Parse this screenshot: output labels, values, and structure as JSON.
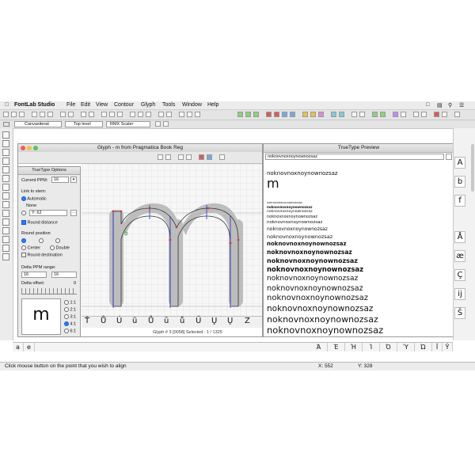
{
  "menubar": {
    "app": "FontLab Studio",
    "items": [
      "File",
      "Edit",
      "View",
      "Contour",
      "Glyph",
      "Tools",
      "Window",
      "Help"
    ]
  },
  "toolbar": {
    "layer_select": "Canvasiterat",
    "level_select": "Top level",
    "scaler_select": "RMX Scaler"
  },
  "glyph_window": {
    "title": "Glyph - m from Pragmatica Book Reg",
    "status": "Glyph # 3 [0058]   Selected : 1 / 1325"
  },
  "truetype_options": {
    "title": "TrueType Options",
    "current_ppm_label": "Current PPM:",
    "current_ppm_value": "16",
    "link_to_stem_label": "Link to stem:",
    "automatic": "Automatic",
    "none": "None",
    "y_value": "Y: 62",
    "round_distance": "Round distance",
    "round_position": "Round position",
    "center": "Center",
    "double": "Double",
    "round_destination": "Round destination",
    "delta_ppm_range": "Delta PPM range:",
    "delta_from": "16",
    "delta_to": "16",
    "delta_offset": "Delta offset:",
    "delta_offset_value": "0",
    "preview_glyph": "m",
    "ratios": [
      "1:1",
      "2:1",
      "3:1",
      "4:1",
      "6:1"
    ],
    "selected_ratio": "4:1"
  },
  "preview_window": {
    "title": "TrueType Preview",
    "input_value": "noknovnoxnoynownozsaz",
    "sample_text": "noknovnoxnoynownozsaz",
    "large_glyph": "m",
    "bold_sample": "noknovnoxnoynownozsaz",
    "lines": [
      "noknovnoxnoynownozsaz",
      "noknovnoxnoynownozsaz",
      "noknovnoxnoynownozsaz",
      "noknovnoxnoynownozsaz",
      "noknovnoxnoynownozsaz",
      "noknovnoxnoynownozsaz",
      "noknovnoxnoynownozsaz",
      "noknovnoxnoynownozsaz",
      "noknovnoxnoynownozsaz",
      "noknovnoxnoynownozsaz",
      "noknovnoxnoynownozsaz",
      "noknovnoxnoynownozsaz",
      "noknovnoxnoynownozsaz"
    ],
    "large_lines": [
      "noknovnoxnoynownozsaz",
      "noknovnoxnoynownozsaz",
      "noknovnoxnoynownozsaz",
      "noknovnoxnoynownozsaz",
      "noknovnoxnoynownozsaz",
      "noknovnoxnoynownozsaz",
      "noknovnoxnoynownozsaz"
    ]
  },
  "right_glyphs": [
    "A",
    "b",
    "f",
    "Å",
    "æ",
    "Ç",
    "ĳ",
    "Š"
  ],
  "glyph_strip": [
    "Ť",
    "Ů",
    "Ú",
    "ũ",
    "Ů",
    "ū",
    "ů",
    "Ű",
    "Ų",
    "Ų",
    "Z"
  ],
  "bottom_glyphs": [
    "a",
    "e"
  ],
  "bottom_right_glyphs": [
    "Ά",
    "Έ",
    "Ή",
    "Ί",
    "Ό",
    "Ύ",
    "Ώ",
    "Ϊ",
    "Ϋ"
  ],
  "status": {
    "message": "Click mouse button on the point that you wish to align",
    "x": "X: 552",
    "y": "Y: 328"
  },
  "colors": {
    "accent": "#2a7bf6",
    "hint": "#2233cc",
    "ghost": "#c0c0c0"
  }
}
